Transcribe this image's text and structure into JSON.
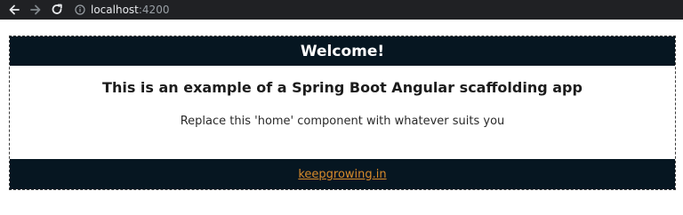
{
  "browser": {
    "url_host": "localhost",
    "url_port": ":4200",
    "icons": [
      "back-arrow-icon",
      "forward-arrow-icon",
      "reload-icon",
      "info-icon"
    ]
  },
  "card": {
    "header": "Welcome!",
    "title": "This is an example of a Spring Boot Angular scaffolding app",
    "text": "Replace this 'home' component with whatever suits you",
    "footer_link": "keepgrowing.in"
  },
  "colors": {
    "header_bg": "#061621",
    "footer_bg": "#061621",
    "link": "#d98b2b",
    "browser_bar": "#202124"
  }
}
